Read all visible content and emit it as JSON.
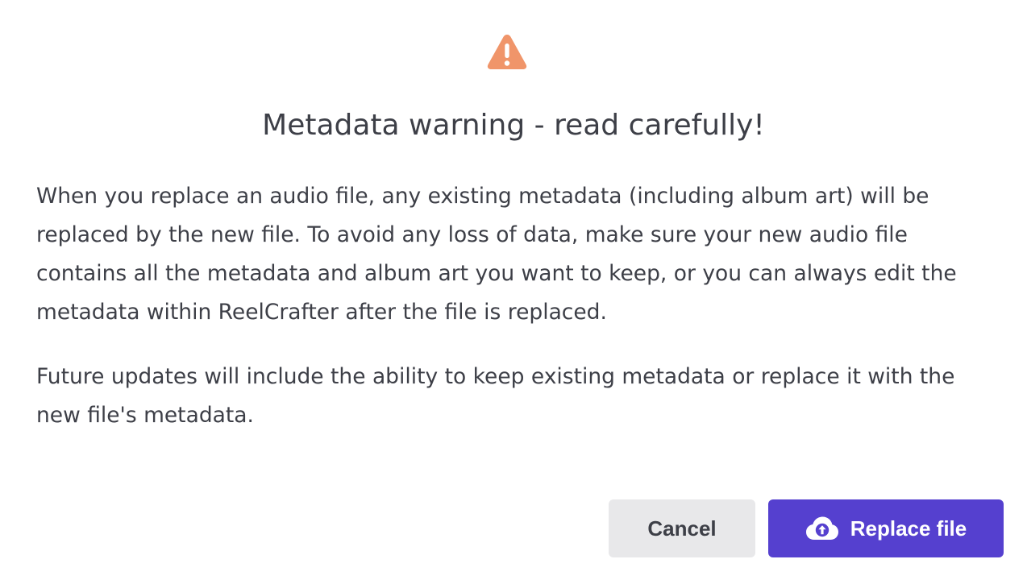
{
  "dialog": {
    "icon": "warning-triangle-icon",
    "icon_color": "#f0956a",
    "title": "Metadata warning - read carefully!",
    "paragraphs": [
      "When you replace an audio file, any existing metadata (including album art) will be replaced by the new file. To avoid any loss of data, make sure your new audio file contains all the metadata and album art you want to keep, or you can always edit the metadata within ReelCrafter after the file is replaced.",
      "Future updates will include the ability to keep existing metadata or replace it with the new file's metadata."
    ],
    "buttons": {
      "cancel_label": "Cancel",
      "replace_label": "Replace file",
      "replace_icon": "cloud-upload-icon"
    },
    "colors": {
      "primary": "#5540cf",
      "secondary_bg": "#e8e8ea",
      "text": "#3d3f47"
    }
  }
}
